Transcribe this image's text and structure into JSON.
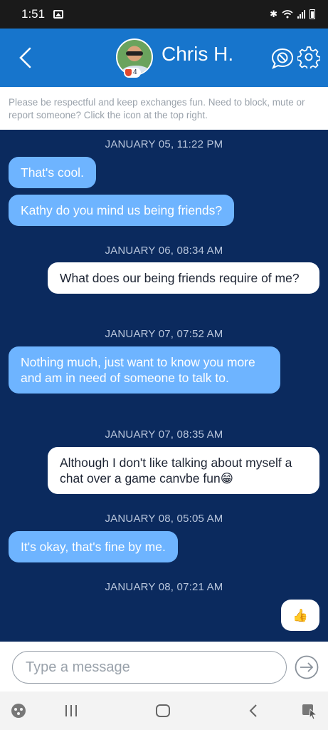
{
  "status_bar": {
    "time": "1:51"
  },
  "header": {
    "contact_name": "Chris H.",
    "level": "4"
  },
  "notice": "Please be respectful and keep exchanges fun. Need to block, mute or report someone? Click the icon at the top right.",
  "messages": [
    {
      "timestamp": "JANUARY 05, 11:22 PM"
    },
    {
      "direction": "in",
      "text": "That's cool."
    },
    {
      "direction": "in",
      "text": "Kathy do you mind us being friends?"
    },
    {
      "timestamp": "JANUARY 06, 08:34 AM"
    },
    {
      "direction": "out",
      "text": "What does our being friends require of me?"
    },
    {
      "timestamp": "JANUARY 07, 07:52 AM"
    },
    {
      "direction": "in",
      "text": "Nothing much, just want to know you more and am in need of someone to talk to."
    },
    {
      "timestamp": "JANUARY 07, 08:35 AM"
    },
    {
      "direction": "out",
      "text": "Although I don't like talking about myself a chat over a game canvbe fun😁"
    },
    {
      "timestamp": "JANUARY 08, 05:05 AM"
    },
    {
      "direction": "in",
      "text": "It's okay, that's fine by me."
    },
    {
      "timestamp": "JANUARY 08, 07:21 AM"
    },
    {
      "direction": "out",
      "text": "👍"
    }
  ],
  "composer": {
    "placeholder": "Type a message"
  },
  "colors": {
    "header": "#1775cc",
    "chat_background": "#0b2a5e",
    "incoming_bubble": "#6eb4ff",
    "outgoing_bubble": "#ffffff"
  }
}
